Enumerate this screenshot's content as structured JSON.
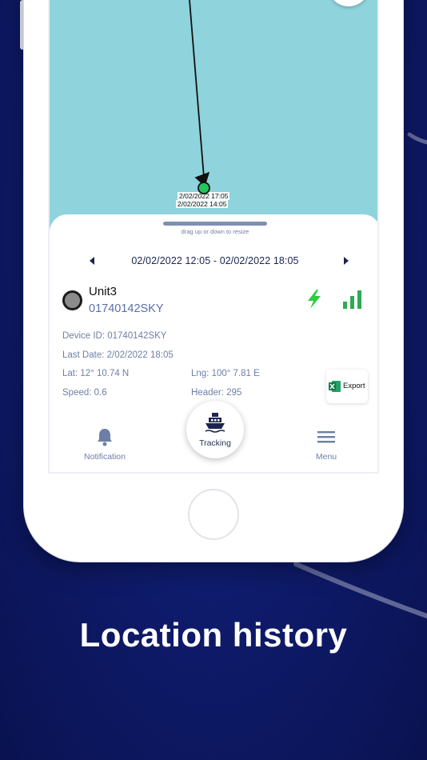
{
  "map": {
    "label_top": "2/02/2022 17:05",
    "label_bottom": "2/02/2022 14:05"
  },
  "panel": {
    "drag_hint": "drag up or down to resize",
    "date_range": "02/02/2022 12:05 - 02/02/2022 18:05",
    "unit_name": "Unit3",
    "unit_id": "01740142SKY",
    "device_id": "Device ID: 01740142SKY",
    "last_date": "Last Date: 2/02/2022 18:05",
    "lat": "Lat: 12° 10.74 N",
    "lng": "Lng: 100° 7.81 E",
    "speed": "Speed: 0.6",
    "header": "Header: 295",
    "export_label": "Export"
  },
  "nav": {
    "notification": "Notification",
    "tracking": "Tracking",
    "menu": "Menu"
  },
  "caption": "Location history",
  "icons": {
    "status_power": "bolt-icon",
    "signal": "signal-bars-icon",
    "export": "excel-icon",
    "notification": "bell-icon",
    "tracking": "ship-icon",
    "menu": "hamburger-icon"
  },
  "colors": {
    "map_water": "#8fd3dc",
    "marker": "#22c55e",
    "accent_text": "#5a6fa8",
    "background": "#0f1c6e"
  }
}
